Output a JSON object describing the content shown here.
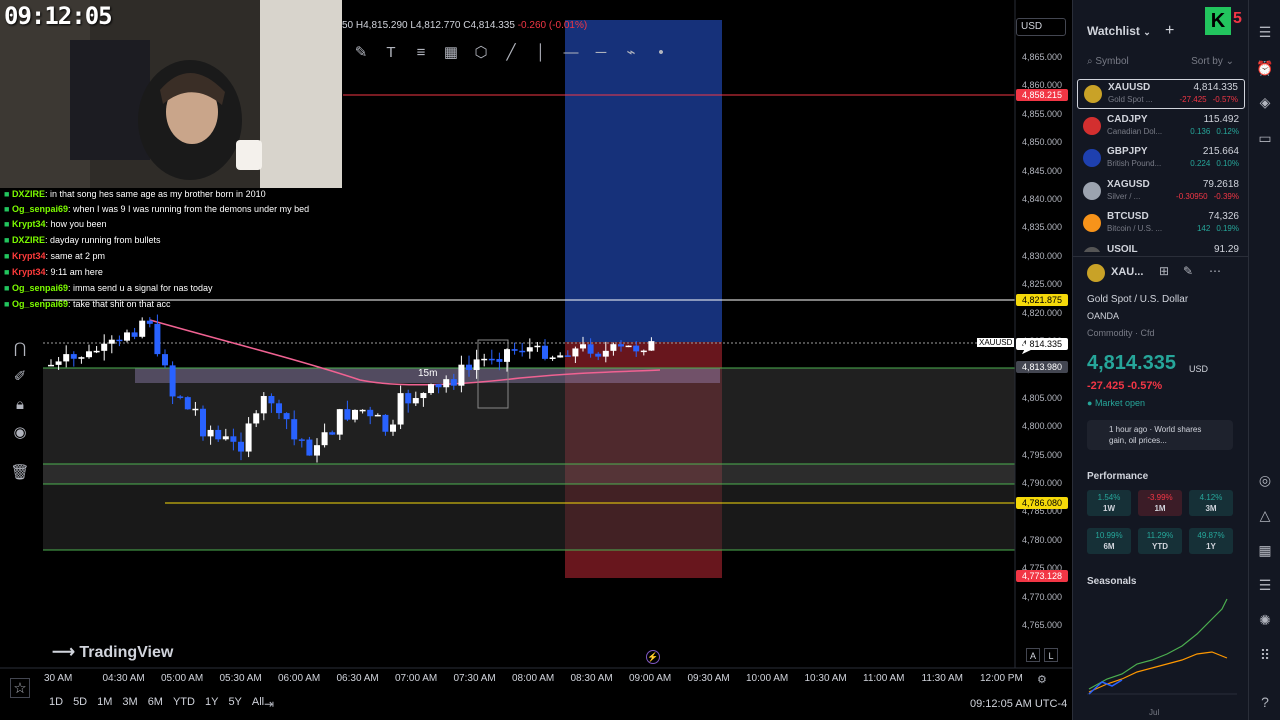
{
  "overlay": {
    "clock": "09:12:05",
    "chat": [
      {
        "user": "DXZIRE",
        "text": ": in that song hes same age as my brother born in 2010",
        "color": "#7cfc00"
      },
      {
        "user": "Og_senpai69",
        "text": ": when I was 9 I was running from the demons under my bed",
        "color": "#7cfc00"
      },
      {
        "user": "Krypt34",
        "text": ": how you been",
        "color": "#7cfc00"
      },
      {
        "user": "DXZIRE",
        "text": ": dayday running from bullets",
        "color": "#7cfc00"
      },
      {
        "user": "Krypt34",
        "text": ": same at 2 pm",
        "color": "#ff3b3b"
      },
      {
        "user": "Krypt34",
        "text": ": 9:11 am here",
        "color": "#ff3b3b"
      },
      {
        "user": "Og_senpai69",
        "text": ": imma send u a signal for nas today",
        "color": "#7cfc00"
      },
      {
        "user": "Og_senpai69",
        "text": ": take that shit on that acc",
        "color": "#7cfc00"
      }
    ]
  },
  "chart": {
    "ohlc": "4,815.290 L4,812.770 C4,814.335 ",
    "ohlc_prefix": "50 H",
    "change": "-0.260 (-0.01%)",
    "currency_button": "USD",
    "interval_label": "15m",
    "symbol_tag": "XAUUSD",
    "price_ticks": [
      "4,865.000",
      "4,860.000",
      "4,855.000",
      "4,850.000",
      "4,845.000",
      "4,840.000",
      "4,835.000",
      "4,830.000",
      "4,825.000",
      "4,820.000",
      "4,815.000",
      "4,810.000",
      "4,805.000",
      "4,800.000",
      "4,795.000",
      "4,790.000",
      "4,785.000",
      "4,780.000",
      "4,775.000",
      "4,770.000",
      "4,765.000"
    ],
    "price_labels": [
      {
        "text": "4,858.215",
        "color": "#f23645"
      },
      {
        "text": "4,821.875",
        "color": "#f5d90a"
      },
      {
        "text": "4,814.335",
        "color": "#ffffff"
      },
      {
        "text": "4,813.980",
        "color": "#434651"
      },
      {
        "text": "4,786.080",
        "color": "#f5d90a"
      },
      {
        "text": "4,773.128",
        "color": "#f23645"
      }
    ],
    "time_ticks": [
      "30 AM",
      "04:30 AM",
      "05:00 AM",
      "05:30 AM",
      "06:00 AM",
      "06:30 AM",
      "07:00 AM",
      "07:30 AM",
      "08:00 AM",
      "08:30 AM",
      "09:00 AM",
      "09:30 AM",
      "10:00 AM",
      "10:30 AM",
      "11:00 AM",
      "11:30 AM",
      "12:00 PM"
    ],
    "timeframes": [
      "1D",
      "5D",
      "1M",
      "3M",
      "6M",
      "YTD",
      "1Y",
      "5Y",
      "All"
    ],
    "datetime": "09:12:05 AM UTC-4",
    "logo_text": "TradingView",
    "auto_btn": "A",
    "log_btn": "L"
  },
  "watchlist": {
    "title": "Watchlist",
    "col_symbol": "Symbol",
    "col_sort": "Sort by",
    "items": [
      {
        "sym": "XAUUSD",
        "desc": "Gold Spot ...",
        "price": "4,814.335",
        "chg": "-27.425",
        "pct": "-0.57%",
        "dir": "neg",
        "icon_color": "#c9a227"
      },
      {
        "sym": "CADJPY",
        "desc": "Canadian Dol...",
        "price": "115.492",
        "chg": "0.136",
        "pct": "0.12%",
        "dir": "pos",
        "icon_color": "#d32f2f"
      },
      {
        "sym": "GBPJPY",
        "desc": "British Pound...",
        "price": "215.664",
        "chg": "0.224",
        "pct": "0.10%",
        "dir": "pos",
        "icon_color": "#1e40af"
      },
      {
        "sym": "XAGUSD",
        "desc": "Silver / ...",
        "price": "79.2618",
        "chg": "-0.30950",
        "pct": "-0.39%",
        "dir": "neg",
        "icon_color": "#9ca3af"
      },
      {
        "sym": "BTCUSD",
        "desc": "Bitcoin / U.S. ...",
        "price": "74,326",
        "chg": "142",
        "pct": "0.19%",
        "dir": "pos",
        "icon_color": "#f7931a"
      },
      {
        "sym": "USOIL",
        "desc": "",
        "price": "91.29",
        "chg": "",
        "pct": "",
        "dir": "pos",
        "icon_color": "#555"
      }
    ]
  },
  "details": {
    "short_sym": "XAU...",
    "title": "Gold Spot / U.S. Dollar",
    "exchange": "OANDA",
    "type": "Commodity · Cfd",
    "price": "4,814.335",
    "unit": "USD",
    "change": "-27.425 -0.57%",
    "market_status": "Market open",
    "news": "1 hour ago · World shares gain, oil prices...",
    "performance_title": "Performance",
    "performance": [
      {
        "v": "1.54%",
        "p": "1W",
        "dir": "g"
      },
      {
        "v": "-3.99%",
        "p": "1M",
        "dir": "r"
      },
      {
        "v": "4.12%",
        "p": "3M",
        "dir": "g"
      },
      {
        "v": "10.99%",
        "p": "6M",
        "dir": "g"
      },
      {
        "v": "11.29%",
        "p": "YTD",
        "dir": "g"
      },
      {
        "v": "49.87%",
        "p": "1Y",
        "dir": "g"
      }
    ],
    "seasonals_title": "Seasonals",
    "seasonals_month": "Jul"
  },
  "colors": {
    "bull": "#ffffff",
    "bear": "#2962ff",
    "ma": "#f06292",
    "green_line": "#4caf50",
    "yellow_line": "#f5d90a",
    "red_line": "#f23645"
  }
}
